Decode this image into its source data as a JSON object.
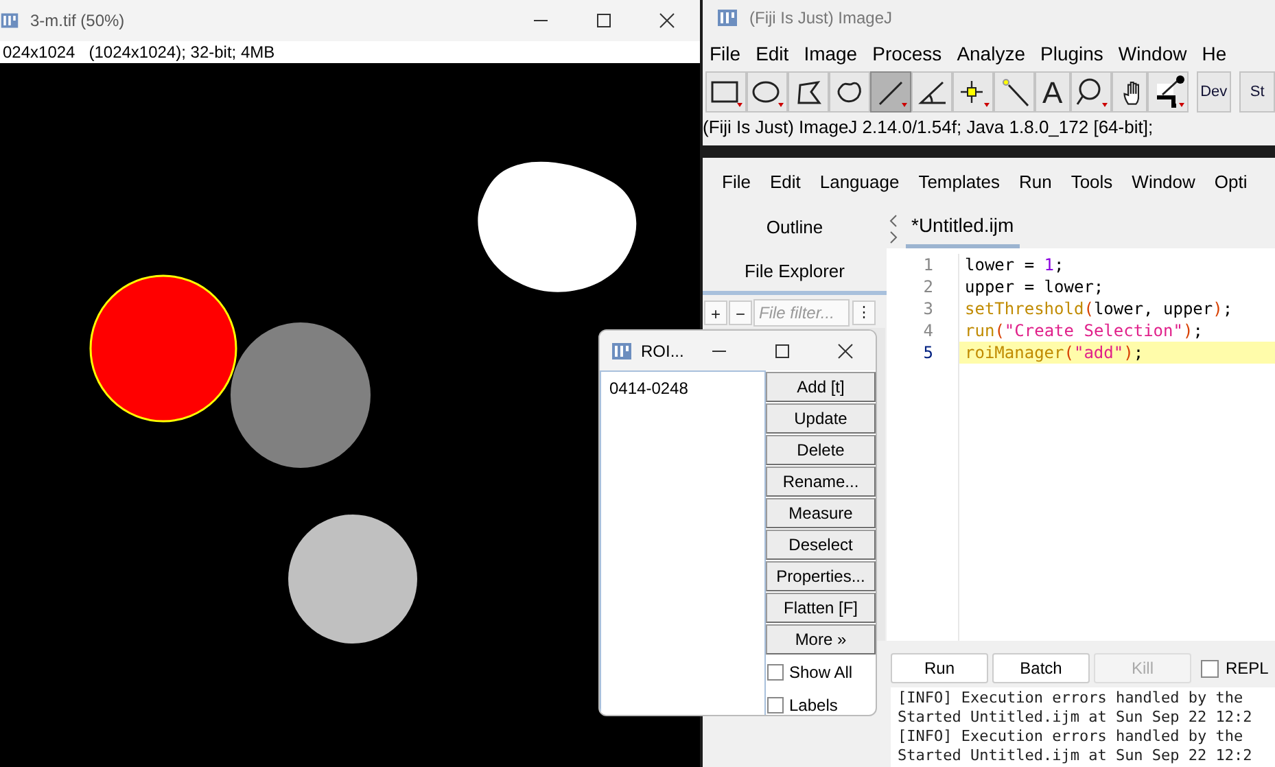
{
  "image_window": {
    "title": "3-m.tif (50%)",
    "info": "024x1024   (1024x1024); 32-bit; 4MB"
  },
  "imagej_window": {
    "title": "(Fiji Is Just) ImageJ",
    "menu": [
      "File",
      "Edit",
      "Image",
      "Process",
      "Analyze",
      "Plugins",
      "Window",
      "He"
    ],
    "tools": [
      {
        "kind": "rectangle",
        "selected": false
      },
      {
        "kind": "oval",
        "selected": false
      },
      {
        "kind": "polygon",
        "selected": false
      },
      {
        "kind": "freehand",
        "selected": false
      },
      {
        "kind": "line",
        "selected": true
      },
      {
        "kind": "angle",
        "selected": false
      },
      {
        "kind": "point",
        "selected": false
      },
      {
        "kind": "wand",
        "selected": false
      },
      {
        "kind": "text",
        "label": "A",
        "selected": false
      },
      {
        "kind": "magnifier",
        "selected": false
      },
      {
        "kind": "hand",
        "selected": false
      },
      {
        "kind": "dropper",
        "selected": false
      },
      {
        "kind": "label",
        "label": "Dev",
        "selected": false
      },
      {
        "kind": "label",
        "label": "St",
        "selected": false
      }
    ],
    "status": "(Fiji Is Just) ImageJ 2.14.0/1.54f; Java 1.8.0_172 [64-bit];"
  },
  "script_editor": {
    "menu": [
      "File",
      "Edit",
      "Language",
      "Templates",
      "Run",
      "Tools",
      "Window",
      "Opti"
    ],
    "side_tabs": [
      {
        "label": "Outline",
        "selected": false
      },
      {
        "label": "File Explorer",
        "selected": true
      }
    ],
    "filter_buttons": [
      "+",
      "−"
    ],
    "filter": {
      "placeholder": "File filter..."
    },
    "filter_menu": "⋮",
    "tab": "*Untitled.ijm",
    "lines": [
      {
        "number": "1",
        "current": false,
        "tokens": [
          {
            "kind": "plain",
            "text": "lower = "
          },
          {
            "kind": "number",
            "text": "1"
          },
          {
            "kind": "plain",
            "text": ";"
          }
        ]
      },
      {
        "number": "2",
        "current": false,
        "tokens": [
          {
            "kind": "plain",
            "text": "upper = lower;"
          }
        ]
      },
      {
        "number": "3",
        "current": false,
        "tokens": [
          {
            "kind": "function",
            "text": "setThreshold"
          },
          {
            "kind": "paren",
            "text": "("
          },
          {
            "kind": "plain",
            "text": "lower, upper"
          },
          {
            "kind": "paren",
            "text": ")"
          },
          {
            "kind": "plain",
            "text": ";"
          }
        ]
      },
      {
        "number": "4",
        "current": false,
        "tokens": [
          {
            "kind": "function",
            "text": "run"
          },
          {
            "kind": "paren",
            "text": "("
          },
          {
            "kind": "string",
            "text": "\"Create Selection\""
          },
          {
            "kind": "paren",
            "text": ")"
          },
          {
            "kind": "plain",
            "text": ";"
          }
        ]
      },
      {
        "number": "5",
        "current": true,
        "tokens": [
          {
            "kind": "function",
            "text": "roiManager"
          },
          {
            "kind": "paren",
            "text": "("
          },
          {
            "kind": "string",
            "text": "\"add\""
          },
          {
            "kind": "paren",
            "text": ")"
          },
          {
            "kind": "plain",
            "text": ";"
          }
        ]
      }
    ],
    "buttons": [
      {
        "label": "Run",
        "disabled": false
      },
      {
        "label": "Batch",
        "disabled": false
      },
      {
        "label": "Kill",
        "disabled": true
      }
    ],
    "repl": {
      "label": "REPL",
      "checked": false
    },
    "console": [
      "[INFO] Execution errors handled by the",
      "Started Untitled.ijm at Sun Sep 22 12:2",
      "[INFO] Execution errors handled by the",
      "Started Untitled.ijm at Sun Sep 22 12:2"
    ]
  },
  "roi_manager": {
    "title": "ROI...",
    "items": [
      "0414-0248"
    ],
    "buttons": [
      "Add [t]",
      "Update",
      "Delete",
      "Rename...",
      "Measure",
      "Deselect",
      "Properties...",
      "Flatten [F]",
      "More »"
    ],
    "options": [
      {
        "label": "Show All",
        "checked": false
      },
      {
        "label": "Labels",
        "checked": false
      }
    ]
  }
}
